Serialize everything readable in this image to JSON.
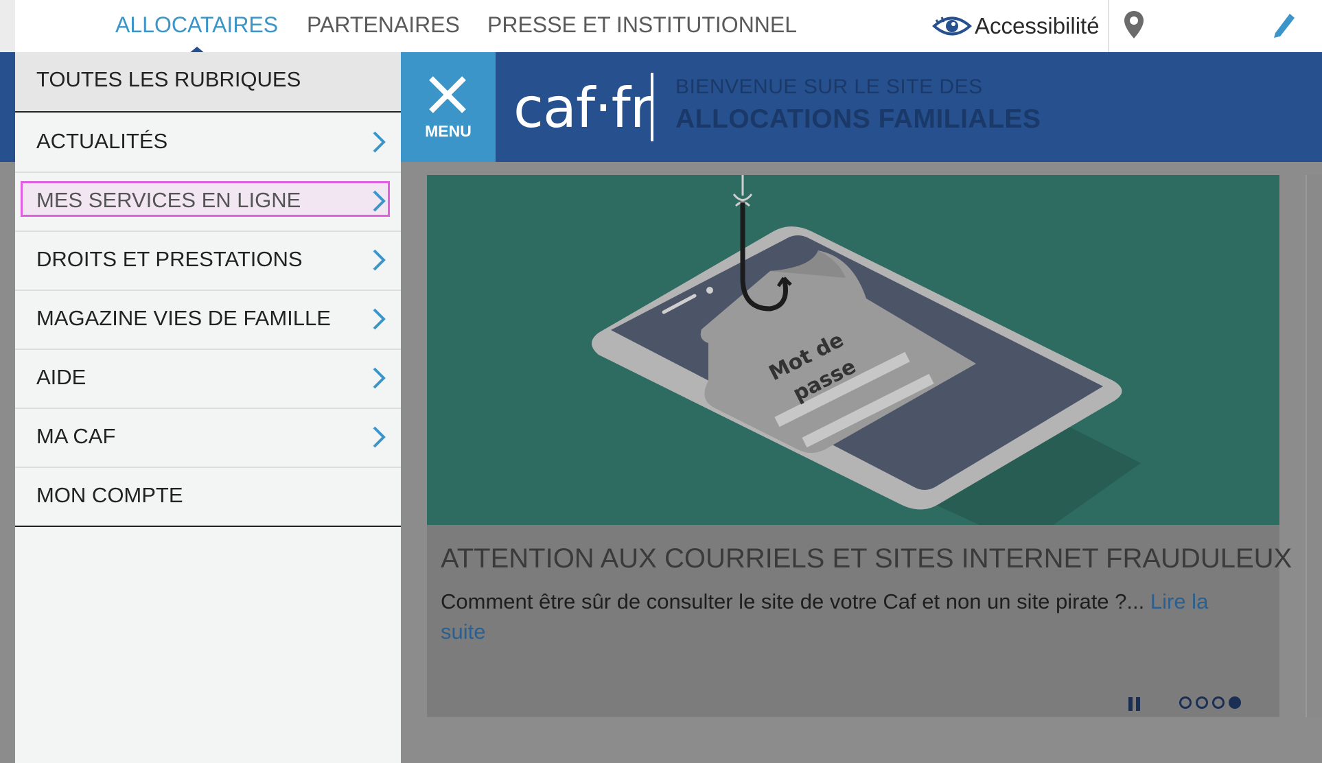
{
  "topnav": {
    "tabs": [
      {
        "label": "ALLOCATAIRES",
        "active": true
      },
      {
        "label": "PARTENAIRES",
        "active": false
      },
      {
        "label": "PRESSE ET INSTITUTIONNEL",
        "active": false
      }
    ],
    "accessibility_label": "Accessibilité",
    "icons": [
      "eye-icon",
      "location-pin-icon",
      "pencil-icon"
    ]
  },
  "header": {
    "menu_label": "MENU",
    "logo_text": "caf·fr",
    "welcome_line1": "BIENVENUE SUR LE SITE DES",
    "welcome_line2": "ALLOCATIONS FAMILIALES"
  },
  "sidebar": {
    "all_label": "TOUTES LES RUBRIQUES",
    "items": [
      {
        "label": "ACTUALITÉS",
        "has_submenu": true
      },
      {
        "label": "MES SERVICES EN LIGNE",
        "has_submenu": true,
        "highlighted": true
      },
      {
        "label": "DROITS ET PRESTATIONS",
        "has_submenu": true
      },
      {
        "label": "MAGAZINE VIES DE FAMILLE",
        "has_submenu": true
      },
      {
        "label": "AIDE",
        "has_submenu": true
      },
      {
        "label": "MA CAF",
        "has_submenu": true
      },
      {
        "label": "MON COMPTE",
        "has_submenu": false
      }
    ]
  },
  "slide": {
    "image_text_line1": "Mot de",
    "image_text_line2": "passe",
    "title": "ATTENTION AUX COURRIELS ET SITES INTERNET FRAUDULEUX",
    "text": "Comment être sûr de consulter le site de votre Caf et non un site pirate ?...",
    "read_more": "Lire la suite",
    "dot_count": 4,
    "active_dot": 4
  },
  "colors": {
    "brand_blue": "#26508e",
    "accent_blue": "#3c95c8",
    "highlight_border": "#e25ee0",
    "slide_green": "#2e6b60"
  }
}
